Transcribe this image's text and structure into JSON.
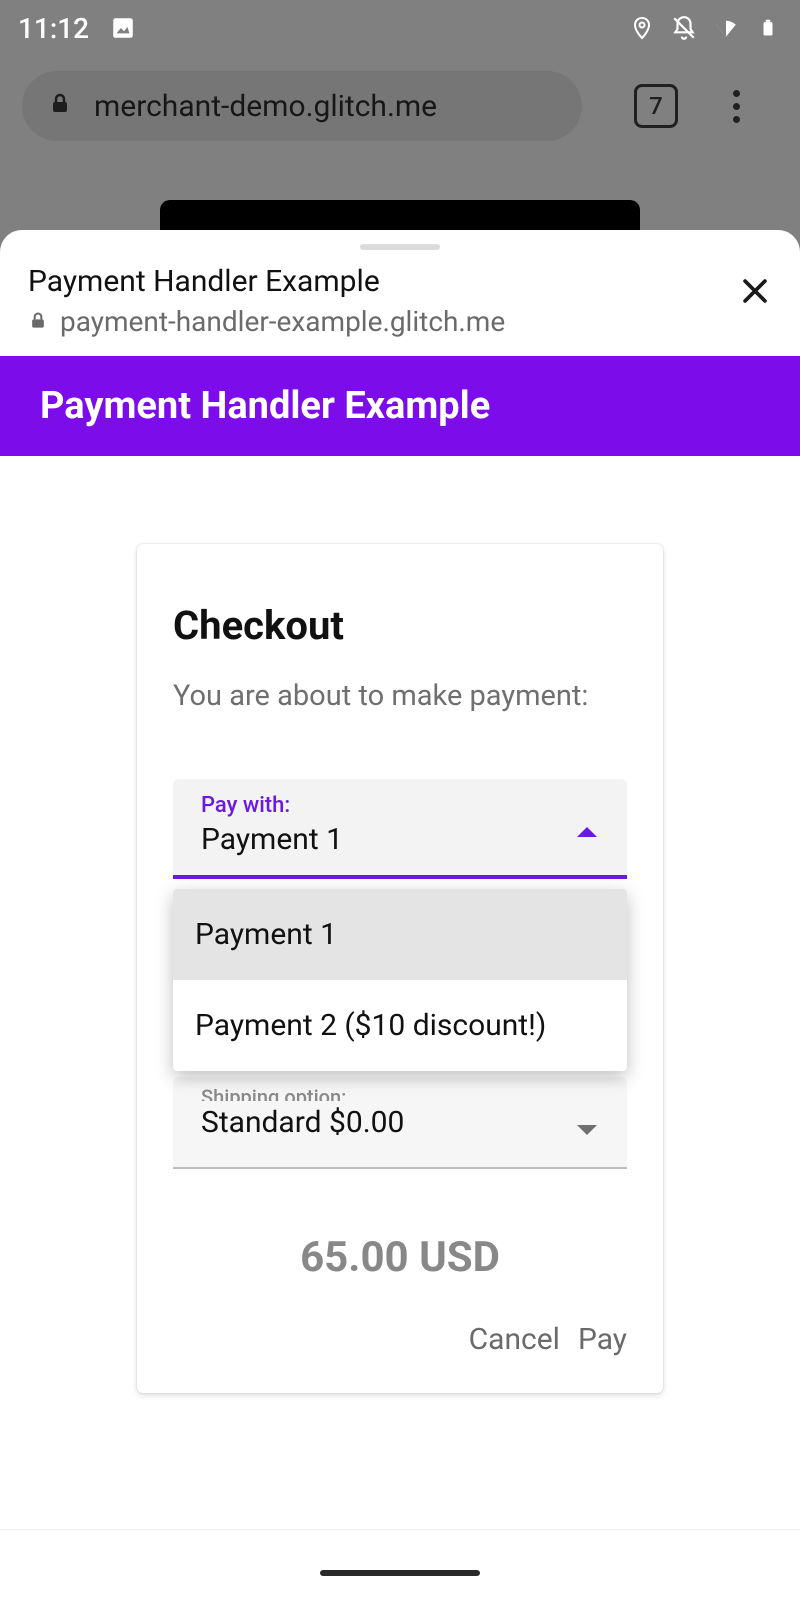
{
  "statusbar": {
    "time": "11:12",
    "tab_count": "7"
  },
  "browser": {
    "url": "merchant-demo.glitch.me"
  },
  "sheet": {
    "title": "Payment Handler Example",
    "origin": "payment-handler-example.glitch.me"
  },
  "brand": {
    "title": "Payment Handler Example"
  },
  "checkout": {
    "title": "Checkout",
    "subtitle": "You are about to make payment:",
    "pay_with_label": "Pay with:",
    "pay_with_value": "Payment 1",
    "options": {
      "0": "Payment 1",
      "1": "Payment 2 ($10 discount!)"
    },
    "shipping_label": "Shipping option:",
    "shipping_value": "Standard $0.00",
    "total": "65.00 USD",
    "cancel": "Cancel",
    "pay": "Pay"
  }
}
